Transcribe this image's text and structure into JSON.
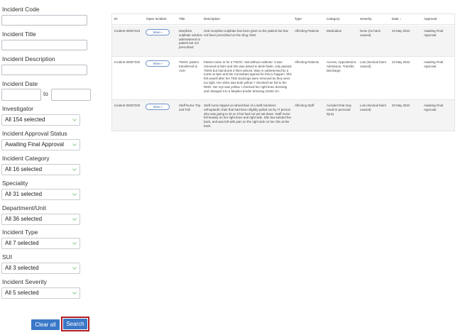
{
  "filters": {
    "incident_code": {
      "label": "Incident Code",
      "value": ""
    },
    "incident_title": {
      "label": "Incident Title",
      "value": ""
    },
    "incident_description": {
      "label": "Incident Description",
      "value": ""
    },
    "incident_date": {
      "label": "Incident Date",
      "to_label": "to",
      "from_value": "",
      "to_value": ""
    },
    "investigator": {
      "label": "Investigator",
      "selected": "All 154 selected"
    },
    "approval_status": {
      "label": "Incident Approval Status",
      "selected": "Awaiting Final Approval"
    },
    "category": {
      "label": "Incident Category",
      "selected": "All 16 selected"
    },
    "speciality": {
      "label": "Speciality",
      "selected": "All 31 selected"
    },
    "department": {
      "label": "Department/Unit",
      "selected": "All 36 selected"
    },
    "incident_type": {
      "label": "Incident Type",
      "selected": "All 7 selected"
    },
    "sui": {
      "label": "SUI",
      "selected": "All 3 selected"
    },
    "severity": {
      "label": "Incident Severity",
      "selected": "All 5 selected"
    },
    "clear_label": "Clear all",
    "search_label": "Search"
  },
  "table": {
    "columns": [
      "ID",
      "Open Incident",
      "Title",
      "Description",
      "Type",
      "Category",
      "Severity",
      "Date ↓",
      "Approval"
    ],
    "view_label": "View »",
    "rows": [
      {
        "id": "Incident 00007423",
        "title": "Morphine sulphate solution administered to patient but not prescribed",
        "description": "Oral morphine sulphate has been given to the patient but has not been prescribed on the drug chart.",
        "type": "Affecting Patients",
        "category": "Medication",
        "severity": "None (no harm caused)",
        "date": "23 May 2022",
        "approval": "Awaiting Final Approval"
      },
      {
        "id": "Incident 00007332",
        "title": "TWOC patient transferred to AUH",
        "description": "Patient came in for a TWOC- trial without catheter- it was removed at 9am and she was asked to drink fluids, only passed 70mls but had drunk 2 litres almost. Was re-catheterised by a nurse at 3pm and the Consultant agreed for this to happen. She felt unwell after her TED stockings were removed as they were too tight. Her shins was both yellow ? checked her full to the RMO. Her eye was yellow. I checked her right knee dressing and changed it to a Mepilex border dressing 10x33 cm.",
        "type": "Affecting Patients",
        "category": "Access, Appointment, Admission, Transfer, Discharge",
        "severity": "Low (minimal harm caused)",
        "date": "23 May 2022",
        "approval": "Awaiting Final Approval"
      },
      {
        "id": "Incident 00007330",
        "title": "Staff Nurse Trip and Fall",
        "description": "Staff nurse tripped on wheelchair of a staff members orthopaedic chair that had been slightly pulled out by IT person who was going to sit on it but had not yet sat down. Staff nurse fell heavily on her right knee and right side. She has twisted her back, and was left with pain on the right side on her ribs at the back.",
        "type": "Affecting Staff",
        "category": "Accident that may result in personal injury",
        "severity": "Low (minimal harm caused)",
        "date": "20 May 2022",
        "approval": "Awaiting Final Approval"
      }
    ]
  },
  "colors": {
    "accent": "#3a78c8",
    "highlight_border": "#b01d22",
    "chevron": "#6fbf73"
  },
  "icons": {
    "select_chevron": "chevron-down-icon"
  }
}
